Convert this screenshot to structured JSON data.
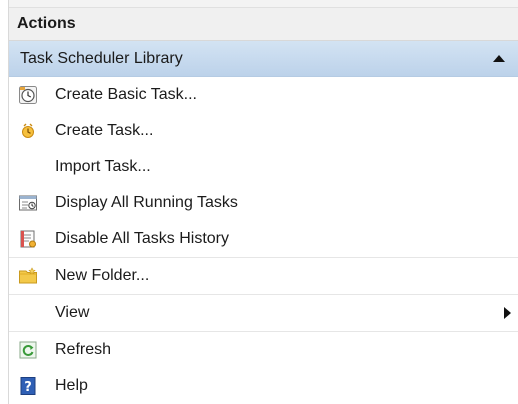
{
  "panel": {
    "title": "Actions",
    "section_title": "Task Scheduler Library"
  },
  "items": [
    {
      "label": "Create Basic Task...",
      "icon": "create-basic-task-icon"
    },
    {
      "label": "Create Task...",
      "icon": "create-task-icon"
    },
    {
      "label": "Import Task...",
      "icon": ""
    },
    {
      "label": "Display All Running Tasks",
      "icon": "running-tasks-icon"
    },
    {
      "label": "Disable All Tasks History",
      "icon": "tasks-history-icon"
    },
    {
      "label": "New Folder...",
      "icon": "folder-icon"
    },
    {
      "label": "View",
      "icon": "",
      "has_submenu": true
    },
    {
      "label": "Refresh",
      "icon": "refresh-icon"
    },
    {
      "label": "Help",
      "icon": "help-icon"
    }
  ],
  "colors": {
    "section_bg": "#c7dbef",
    "folder": "#f3c94a",
    "refresh": "#3a9a3a",
    "help": "#2f5fb5"
  }
}
